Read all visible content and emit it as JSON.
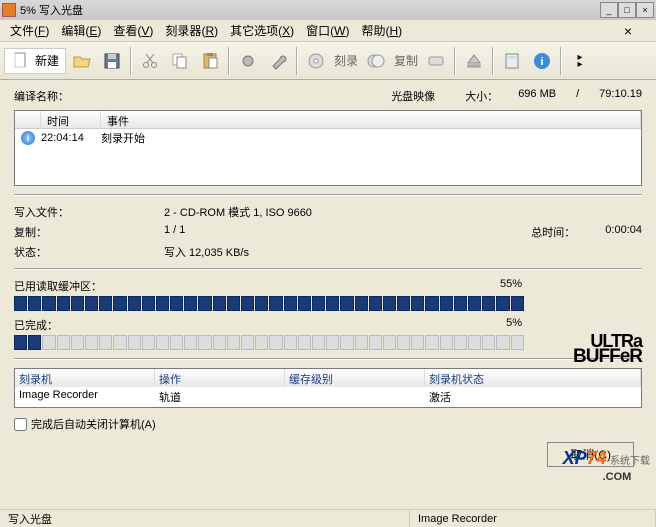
{
  "titlebar": {
    "title": "5%  写入光盘"
  },
  "menu": {
    "file": "文件",
    "file_key": "F",
    "edit": "编辑",
    "edit_key": "E",
    "view": "查看",
    "view_key": "V",
    "recorder": "刻录器",
    "recorder_key": "R",
    "other": "其它选项",
    "other_key": "X",
    "window": "窗口",
    "window_key": "W",
    "help": "帮助",
    "help_key": "H"
  },
  "toolbar": {
    "new": "新建",
    "burn": "刻录",
    "copy": "复制"
  },
  "header": {
    "name_lbl": "编译名称：",
    "image_type": "光盘映像",
    "size_lbl": "大小：",
    "size_val": "696 MB",
    "duration": "79:10.19"
  },
  "events": {
    "col_time": "时间",
    "col_event": "事件",
    "rows": [
      {
        "time": "22:04:14",
        "event": "刻录开始"
      }
    ]
  },
  "details": {
    "write_file_lbl": "写入文件：",
    "write_file_val": "2 - CD-ROM 模式 1, ISO 9660",
    "copy_lbl": "复制：",
    "copy_val": "1 / 1",
    "status_lbl": "状态：",
    "status_val": "写入 12,035 KB/s",
    "total_time_lbl": "总时间：",
    "total_time_val": "0:00:04"
  },
  "progress": {
    "buf_lbl": "已用读取缓冲区：",
    "buf_pct": "55%",
    "done_lbl": "已完成：",
    "done_pct": "5%"
  },
  "recorders": {
    "col_rec": "刻录机",
    "col_op": "操作",
    "col_buf": "缓存级别",
    "col_stat": "刻录机状态",
    "rows": [
      {
        "recorder": "Image Recorder",
        "op": "轨道",
        "buf": "",
        "status": "激活"
      }
    ]
  },
  "checkbox": {
    "label": "完成后自动关闭计算机(A)"
  },
  "buttons": {
    "cancel": "取消(C)"
  },
  "statusbar": {
    "left": "写入光盘",
    "right": "Image Recorder"
  },
  "logo": {
    "xp": "XP",
    "n": "74",
    "com": ".COM",
    "sub": "系统下载"
  }
}
